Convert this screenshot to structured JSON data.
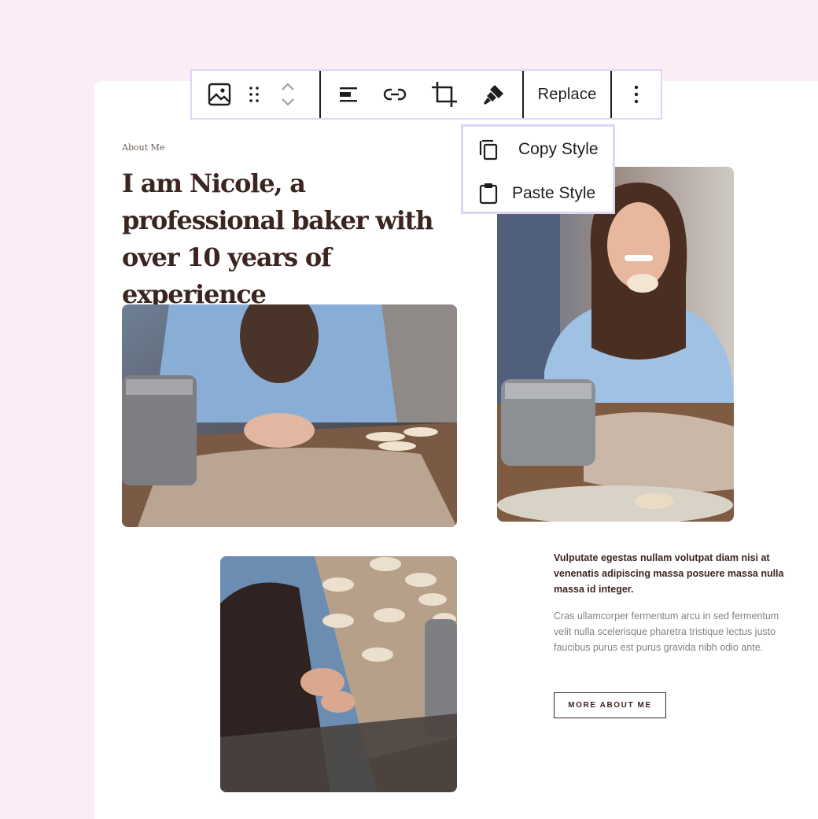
{
  "toolbar": {
    "icons": [
      "image-icon",
      "drag-handle-icon",
      "move-up-icon",
      "move-down-icon",
      "align-icon",
      "link-icon",
      "crop-icon",
      "paint-brush-icon",
      "more-options-icon"
    ],
    "replace_label": "Replace"
  },
  "style_menu": {
    "copy_label": "Copy Style",
    "paste_label": "Paste Style"
  },
  "content": {
    "eyebrow": "About Me",
    "headline": "I am Nicole, a professional baker with over 10 years of experience",
    "lead": "Vulputate egestas nullam volutpat diam nisi at venenatis adipiscing massa posuere massa nulla massa id integer.",
    "body": "Cras ullamcorper fermentum arcu in sed fermentum velit nulla scelerisque pharetra tristique lectus justo faucibus purus est purus gravida nibh odio ante.",
    "cta_label": "MORE ABOUT ME"
  },
  "colors": {
    "page_bg": "#fcecf6",
    "accent_border": "#dcd6f5",
    "heading": "#3b2520",
    "muted_text": "#8a7f7c"
  }
}
